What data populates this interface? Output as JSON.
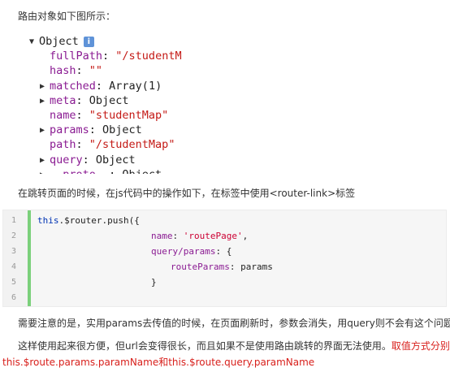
{
  "intro": "路由对象如下图所示：",
  "tree": {
    "root_label": "Object",
    "info_badge": "i",
    "rows": [
      {
        "key": "fullPath",
        "value": "\"/studentM",
        "type": "string",
        "expandable": false
      },
      {
        "key": "hash",
        "value": "\"\"",
        "type": "string",
        "expandable": false
      },
      {
        "key": "matched",
        "value": "Array(1)",
        "type": "plain",
        "expandable": true
      },
      {
        "key": "meta",
        "value": "Object",
        "type": "plain",
        "expandable": true
      },
      {
        "key": "name",
        "value": "\"studentMap\"",
        "type": "string",
        "expandable": false
      },
      {
        "key": "params",
        "value": "Object",
        "type": "plain",
        "expandable": true
      },
      {
        "key": "path",
        "value": "\"/studentMap\"",
        "type": "string",
        "expandable": false
      },
      {
        "key": "query",
        "value": "Object",
        "type": "plain",
        "expandable": true
      }
    ]
  },
  "caption": "在跳转页面的时候，在js代码中的操作如下，在标签中使用<router-link>标签",
  "code": {
    "line_numbers": [
      "1",
      "2",
      "3",
      "4",
      "5",
      "6"
    ],
    "l1_this": "this",
    "l1_rest": ".$router.push({",
    "l2_key": "name",
    "l2_sep": ": ",
    "l2_val": "'routePage'",
    "l2_end": ",",
    "l3_key": "query/params",
    "l3_rest": ": {",
    "l4_key": "routeParams",
    "l4_rest": ": params",
    "l5": "}"
  },
  "note1": "需要注意的是，实用params去传值的时候，在页面刷新时，参数会消失，用query则不会有这个问题。",
  "note2_plain": "这样使用起来很方便，但url会变得很长，而且如果不是使用路由跳转的界面无法使用。",
  "note2_red": "取值方式分别为：",
  "note3": "this.$route.params.paramName和this.$route.query.paramName",
  "colors": {
    "accent_red": "#d8201c",
    "gutter_bar": "#7bd07b",
    "info_blue": "#5f93d8"
  }
}
